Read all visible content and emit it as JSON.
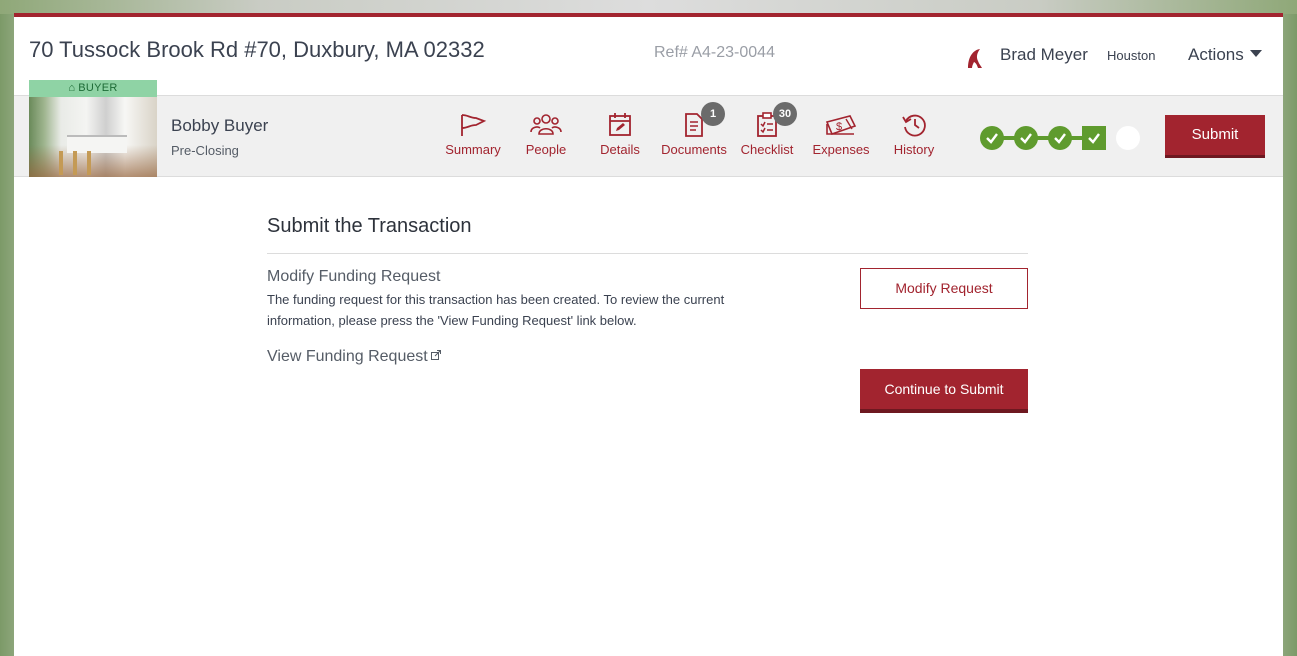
{
  "header": {
    "address": "70 Tussock Brook Rd #70, Duxbury, MA 02332",
    "ref": "Ref# A4-23-0044",
    "user_name": "Brad Meyer",
    "office": "Houston",
    "actions_label": "Actions"
  },
  "contact": {
    "tag": "BUYER",
    "name": "Bobby Buyer",
    "status": "Pre-Closing"
  },
  "nav": {
    "items": [
      {
        "label": "Summary",
        "icon": "flag-icon"
      },
      {
        "label": "People",
        "icon": "people-icon"
      },
      {
        "label": "Details",
        "icon": "calendar-edit-icon"
      },
      {
        "label": "Documents",
        "icon": "document-icon",
        "badge": "1"
      },
      {
        "label": "Checklist",
        "icon": "checklist-icon",
        "badge": "30"
      },
      {
        "label": "Expenses",
        "icon": "money-icon"
      },
      {
        "label": "History",
        "icon": "history-icon"
      }
    ]
  },
  "progress": {
    "steps": [
      "complete",
      "complete",
      "complete",
      "current",
      "pending"
    ],
    "color": "#5f9b2e"
  },
  "submit_label": "Submit",
  "main": {
    "title": "Submit the Transaction",
    "modify_title": "Modify Funding Request",
    "modify_desc": "The funding request for this transaction has been created. To review the current information, please press the 'View Funding Request' link below.",
    "view_link": "View Funding Request",
    "modify_button": "Modify Request",
    "continue_button": "Continue to Submit"
  },
  "colors": {
    "accent": "#a2242f",
    "success": "#5f9b2e",
    "badge": "#6b6b6b"
  }
}
